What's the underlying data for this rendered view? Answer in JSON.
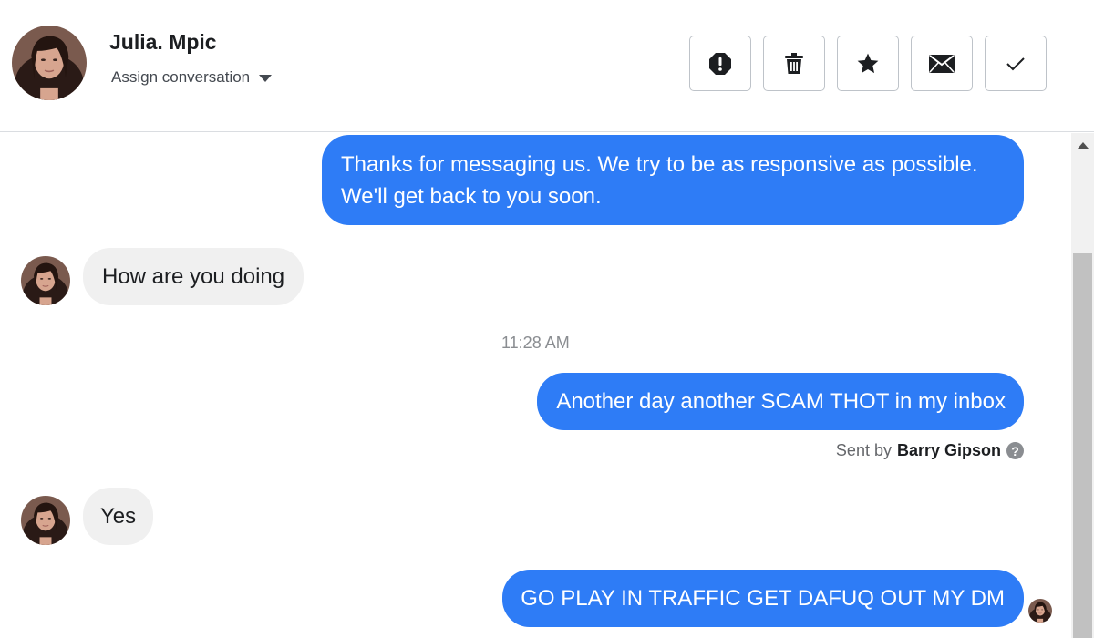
{
  "contact": {
    "name": "Julia. Mpic",
    "assign_label": "Assign conversation"
  },
  "toolbar": {
    "buttons": [
      {
        "name": "report-spam-button",
        "icon": "alert-octagon-icon"
      },
      {
        "name": "delete-button",
        "icon": "trash-icon"
      },
      {
        "name": "star-button",
        "icon": "star-icon"
      },
      {
        "name": "mark-unread-button",
        "icon": "envelope-icon"
      },
      {
        "name": "mark-done-button",
        "icon": "checkmark-icon"
      }
    ]
  },
  "messages": [
    {
      "direction": "outgoing",
      "text": "Thanks for messaging us. We try to be as responsive as possible. We'll get back to you soon."
    },
    {
      "direction": "incoming",
      "text": "How are you doing"
    },
    {
      "direction": "outgoing",
      "text": "Another day another SCAM THOT in my inbox"
    },
    {
      "direction": "incoming",
      "text": "Yes"
    },
    {
      "direction": "outgoing",
      "text": "GO PLAY IN TRAFFIC GET DAFUQ OUT MY DM"
    }
  ],
  "timestamp": "11:28 AM",
  "sent_by": {
    "prefix": "Sent by",
    "name": "Barry Gipson"
  },
  "colors": {
    "outgoing_bubble": "#2e7cf6",
    "incoming_bubble": "#f0f0f0"
  }
}
